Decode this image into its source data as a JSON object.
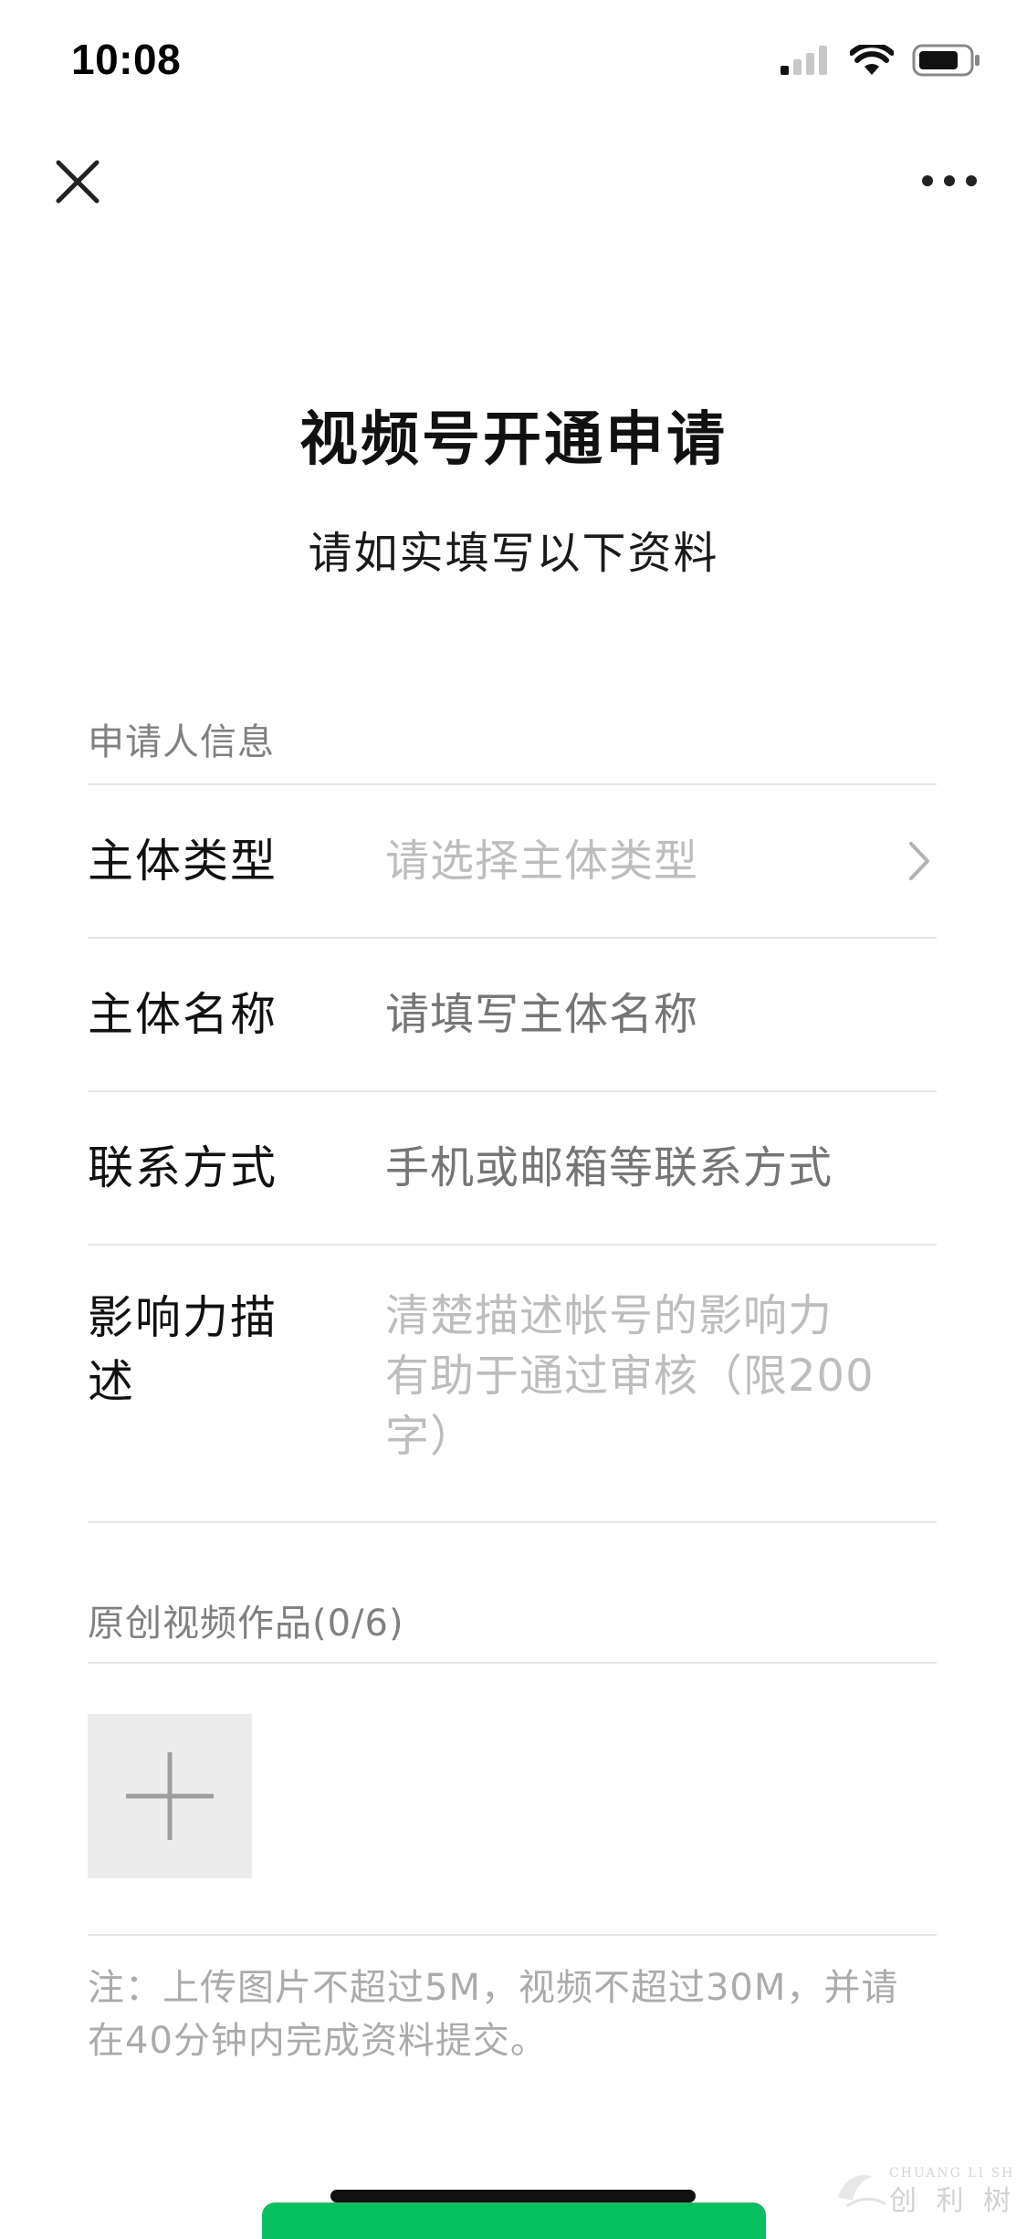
{
  "status_bar": {
    "time": "10:08",
    "icons": [
      "cellular-signal-icon",
      "wifi-icon",
      "battery-icon"
    ]
  },
  "nav": {
    "close_icon": "close-icon",
    "more_icon": "more-dots-icon"
  },
  "header": {
    "title": "视频号开通申请",
    "subtitle": "请如实填写以下资料"
  },
  "applicant_section": {
    "title": "申请人信息",
    "fields": [
      {
        "label": "主体类型",
        "placeholder": "请选择主体类型"
      },
      {
        "label": "主体名称",
        "placeholder": "请填写主体名称"
      },
      {
        "label": "联系方式",
        "placeholder": "手机或邮箱等联系方式"
      },
      {
        "label_line1": "影响力描",
        "label_line2": "述",
        "placeholder_line1": "清楚描述帐号的影响力",
        "placeholder_line2": "有助于通过审核（限200",
        "placeholder_line3": "字）"
      }
    ]
  },
  "works_section": {
    "title": "原创视频作品(0/6)",
    "add_icon": "plus-icon"
  },
  "note": {
    "line1": "注：上传图片不超过5M，视频不超过30M，并请",
    "line2": "在40分钟内完成资料提交。"
  },
  "watermark": {
    "latin": "CHUANG LI SHU",
    "cjk": "创 利 树"
  },
  "colors": {
    "accent_green": "#07c160",
    "placeholder": "#bdbdbd",
    "section_header": "#808080",
    "divider": "#e6e6e6",
    "upload_bg": "#ececec"
  }
}
